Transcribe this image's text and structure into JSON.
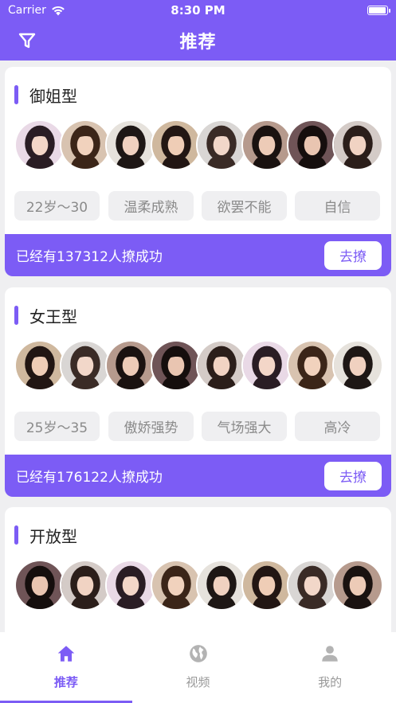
{
  "status_bar": {
    "carrier": "Carrier",
    "time": "8:30 PM",
    "battery_level": 1.0
  },
  "nav": {
    "title": "推荐",
    "filter_icon": "filter-icon"
  },
  "colors": {
    "accent": "#7c5cf5",
    "tag_bg": "#efeff1",
    "tag_text": "#8a8a8a"
  },
  "cards": [
    {
      "title": "御姐型",
      "tags": [
        "22岁～30",
        "温柔成熟",
        "欲罢不能",
        "自信"
      ],
      "footer_text": "已经有137312人撩成功",
      "button_label": "去撩",
      "avatar_count": 8
    },
    {
      "title": "女王型",
      "tags": [
        "25岁～35",
        "傲娇强势",
        "气场强大",
        "高冷"
      ],
      "footer_text": "已经有176122人撩成功",
      "button_label": "去撩",
      "avatar_count": 8
    },
    {
      "title": "开放型",
      "tags": [],
      "footer_text": "",
      "button_label": "",
      "avatar_count": 8
    }
  ],
  "tabs": [
    {
      "label": "推荐",
      "icon": "home-icon",
      "active": true
    },
    {
      "label": "视频",
      "icon": "globe-icon",
      "active": false
    },
    {
      "label": "我的",
      "icon": "person-icon",
      "active": false
    }
  ]
}
